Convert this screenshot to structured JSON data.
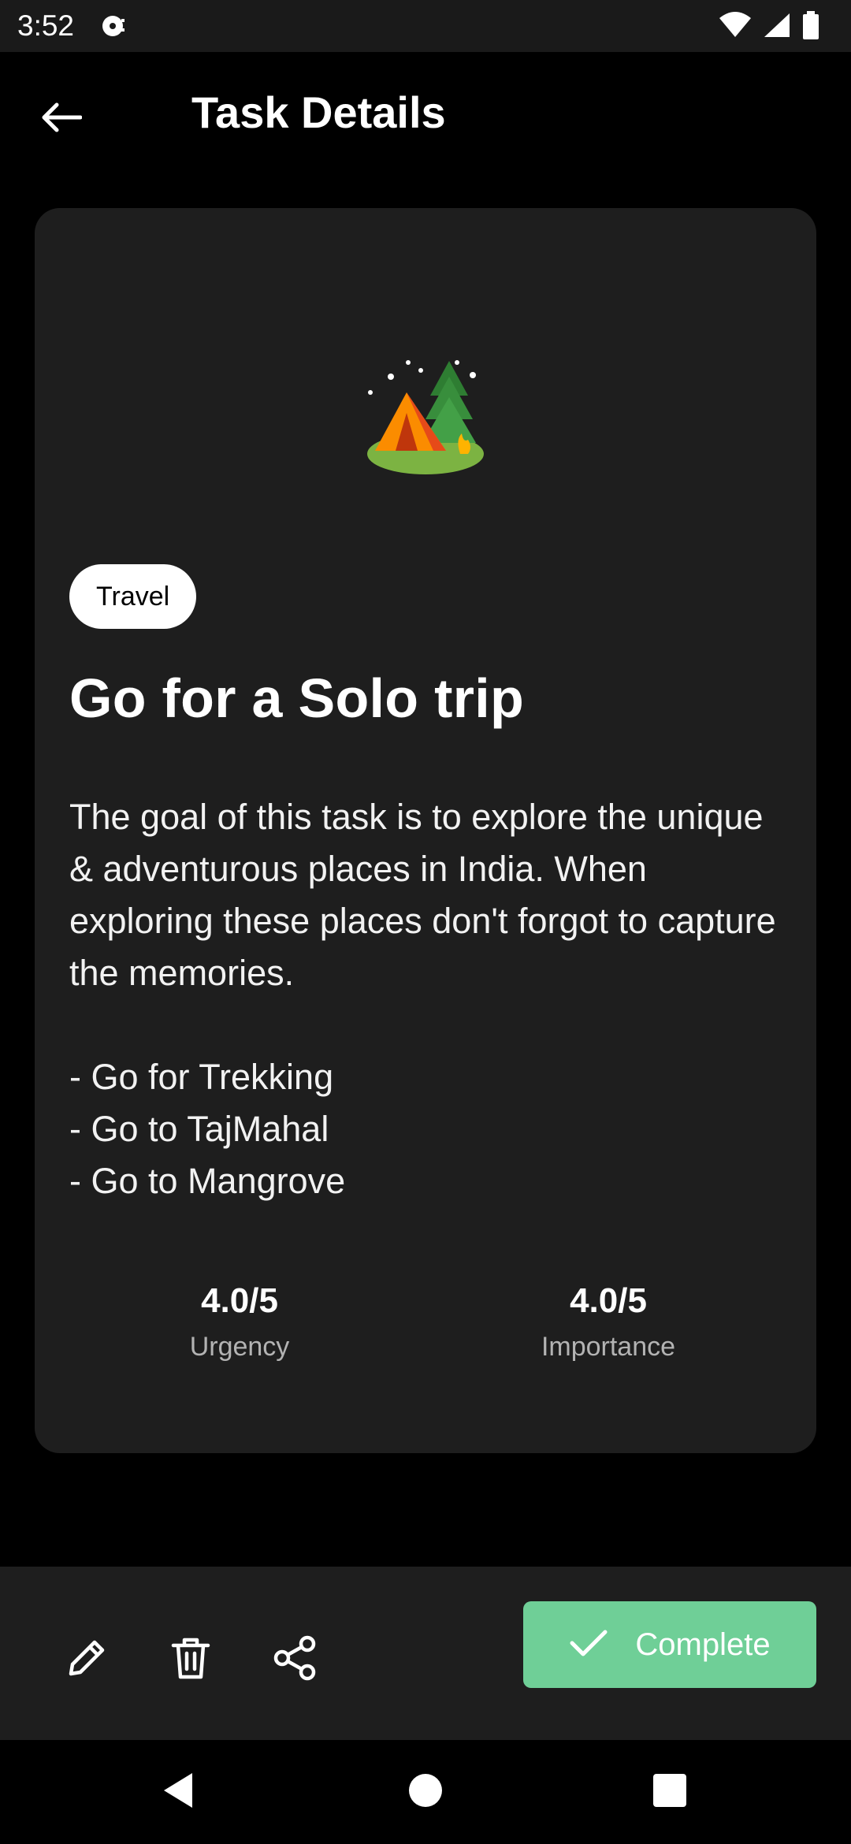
{
  "status_bar": {
    "time": "3:52",
    "icons": [
      "media-icon",
      "wifi-icon",
      "signal-icon",
      "battery-icon"
    ]
  },
  "header": {
    "title": "Task Details",
    "back_icon": "arrow-left-icon"
  },
  "task": {
    "emoji_icon": "camping-tent-icon",
    "tag": "Travel",
    "title": "Go for a Solo trip",
    "description": "The goal of this task is to explore the unique & adventurous places in India. When exploring these places don't forgot to capture the memories.\n\n- Go for Trekking\n- Go to TajMahal\n- Go to Mangrove",
    "metrics": {
      "urgency": {
        "value": "4.0/5",
        "label": "Urgency"
      },
      "importance": {
        "value": "4.0/5",
        "label": "Importance"
      }
    }
  },
  "actions": {
    "edit_icon": "pencil-icon",
    "delete_icon": "trash-icon",
    "share_icon": "share-icon",
    "complete_label": "Complete",
    "complete_color": "#6fcf97"
  },
  "nav": {
    "icons": [
      "nav-back-icon",
      "nav-home-icon",
      "nav-recents-icon"
    ]
  },
  "colors": {
    "background": "#000000",
    "card": "#1e1e1e",
    "accent": "#6fcf97"
  }
}
